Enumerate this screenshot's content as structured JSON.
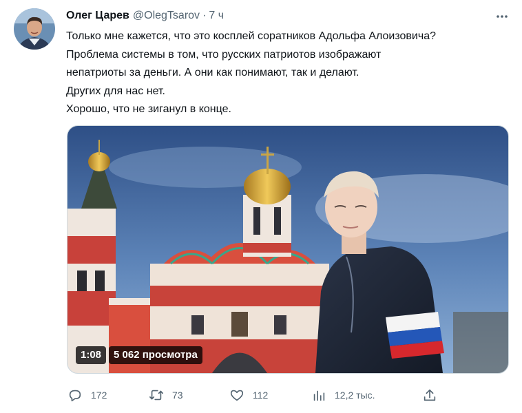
{
  "tweet": {
    "author_name": "Олег Царев",
    "handle": "@OlegTsarov",
    "separator": "·",
    "time": "7 ч",
    "text_lines": [
      "Только мне кажется, что это косплей соратников Адольфа Алоизовича?",
      "Проблема системы в том, что русских патриотов изображают",
      "непатриоты за деньги. А они как понимают, так и делают.",
      "Других для нас нет.",
      "Хорошо, что не зиганул в конце."
    ]
  },
  "video": {
    "duration": "1:08",
    "views": "5 062 просмотра"
  },
  "actions": {
    "replies": "172",
    "retweets": "73",
    "likes": "112",
    "views": "12,2 тыс."
  },
  "icons": {
    "more": "more-dots-icon",
    "reply": "reply-icon",
    "retweet": "retweet-icon",
    "like": "heart-icon",
    "views": "views-chart-icon",
    "share": "share-icon"
  },
  "colors": {
    "text": "#0f1419",
    "secondary": "#536471",
    "border": "#cfd9de"
  }
}
